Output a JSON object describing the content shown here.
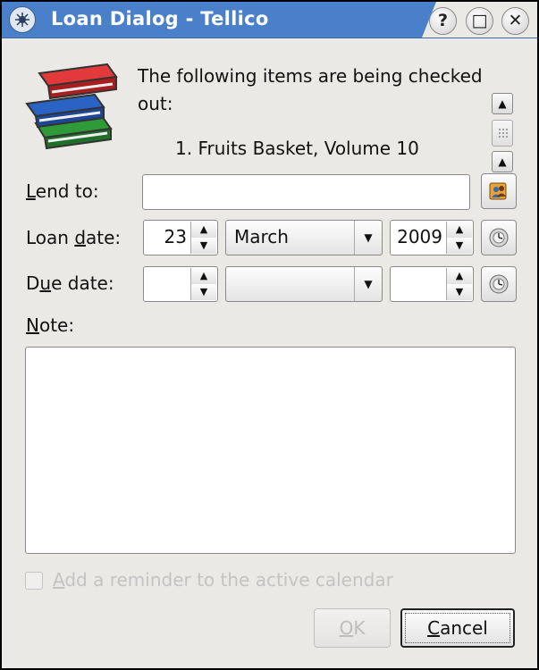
{
  "window": {
    "title": "Loan Dialog - Tellico",
    "buttons": {
      "help": "?",
      "maximize": "□",
      "close": "✕"
    }
  },
  "header": {
    "message": "The following items are being checked out:",
    "items": [
      "1. Fruits Basket, Volume 10"
    ]
  },
  "lend_to": {
    "label_prefix": "",
    "label_mnemonic": "L",
    "label_rest": "end to:",
    "value": ""
  },
  "loan_date": {
    "label_prefix": "Loan ",
    "label_mnemonic": "d",
    "label_rest": "ate:",
    "day": "23",
    "month": "March",
    "year": "2009"
  },
  "due_date": {
    "label_prefix": "D",
    "label_mnemonic": "u",
    "label_rest": "e date:",
    "day": "",
    "month": "",
    "year": ""
  },
  "note": {
    "label_mnemonic": "N",
    "label_rest": "ote:",
    "value": ""
  },
  "reminder": {
    "label_mnemonic": "A",
    "label_rest": "dd a reminder to the active calendar",
    "checked": false,
    "enabled": false
  },
  "footer": {
    "ok": {
      "mnemonic": "O",
      "rest": "K",
      "enabled": false
    },
    "cancel": {
      "mnemonic": "C",
      "rest": "ancel"
    }
  },
  "colors": {
    "titlebar": "#4a7fc9",
    "window_bg": "#ebe9e6"
  }
}
